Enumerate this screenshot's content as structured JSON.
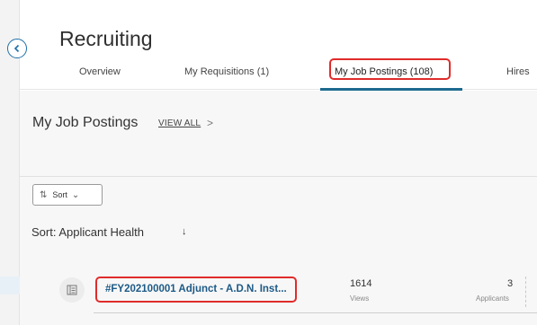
{
  "header": {
    "title": "Recruiting",
    "tabs": [
      {
        "label": "Overview"
      },
      {
        "label": "My Requisitions (1)"
      },
      {
        "label": "My Job Postings (108)"
      },
      {
        "label": "Hires"
      }
    ],
    "active_tab_index": 2
  },
  "section": {
    "title": "My Job Postings",
    "view_all": "VIEW ALL",
    "view_all_chevron": ">"
  },
  "sort": {
    "button_label": "Sort",
    "label": "Sort: Applicant Health",
    "arrow": "↓"
  },
  "job_postings": [
    {
      "title": "#FY202100001 Adjunct - A.D.N. Inst...",
      "views": "1614",
      "views_label": "Views",
      "applicants": "3",
      "applicants_label": "Applicants"
    }
  ],
  "colors": {
    "accent": "#1d6a8f",
    "link": "#1d5a86",
    "highlight_outline": "#e02b2b"
  }
}
